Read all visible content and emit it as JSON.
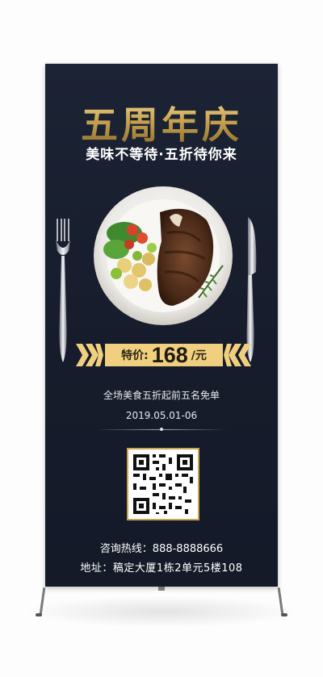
{
  "banner": {
    "title": "五周年庆",
    "subtitle": "美味不等待·五折待你来",
    "price": {
      "label": "特价:",
      "amount": "168",
      "unit": "/元"
    },
    "promo_text": "全场美食五折起前五名免单",
    "date_range": "2019.05.01-06",
    "hotline": "咨询热线：888-8888666",
    "address": "地址：稿定大厦1栋2单元5楼108"
  },
  "colors": {
    "background": "#1a2132",
    "gold": "#f0d07e",
    "gold_dark": "#c9a451",
    "text": "#ffffff"
  },
  "icons": [
    "fork-icon",
    "knife-icon",
    "plate-illustration",
    "qr-code"
  ]
}
